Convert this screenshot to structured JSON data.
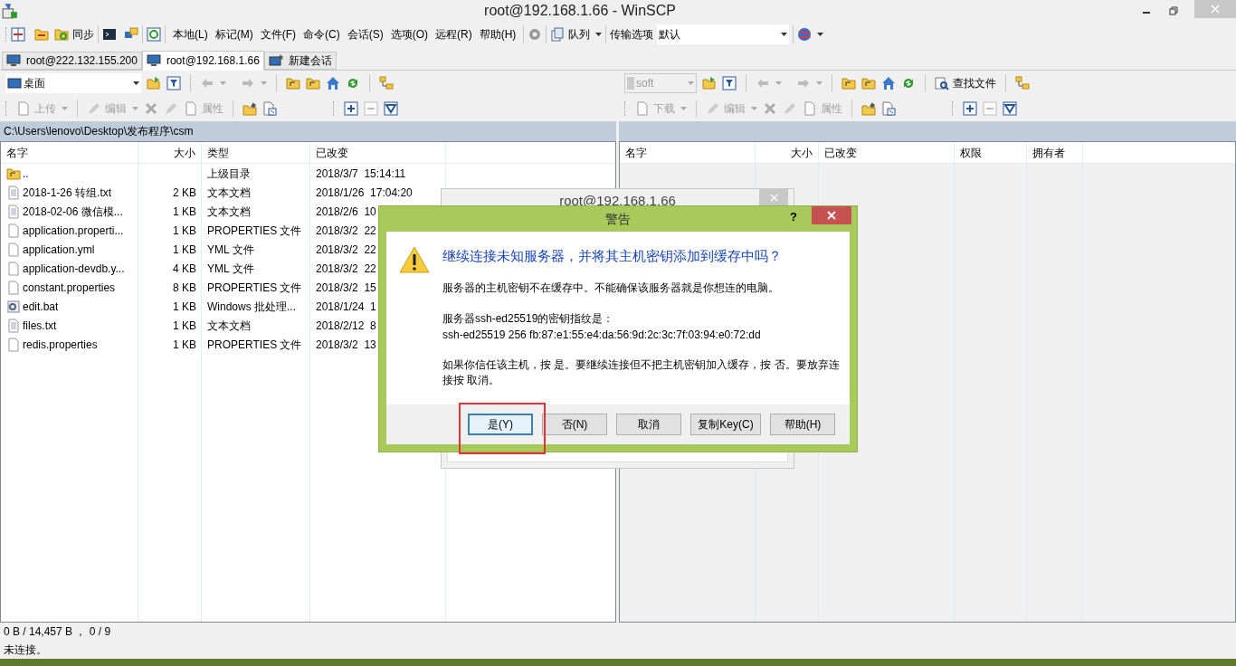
{
  "window": {
    "title": "root@192.168.1.66 - WinSCP"
  },
  "toolbar": {
    "sync_label": "同步",
    "menus": [
      "本地(L)",
      "标记(M)",
      "文件(F)",
      "命令(C)",
      "会话(S)",
      "选项(O)",
      "远程(R)",
      "帮助(H)"
    ],
    "queue_label": "队列",
    "transfer_label": "传输选项",
    "transfer_value": "默认"
  },
  "tabs": [
    {
      "label": "root@222.132.155.200",
      "selected": false
    },
    {
      "label": "root@192.168.1.66",
      "selected": true
    },
    {
      "label": "新建会话",
      "selected": false
    }
  ],
  "left_panel": {
    "location": "桌面",
    "location_disabled": false,
    "buttons": [
      {
        "label": "上传",
        "disabled": true
      },
      {
        "label": "编辑",
        "disabled": true
      },
      {
        "label": "属性",
        "disabled": true
      }
    ],
    "path": "C:\\Users\\lenovo\\Desktop\\发布程序\\csm",
    "columns": [
      "名字",
      "大小",
      "类型",
      "已改变"
    ],
    "rows": [
      {
        "kind": "parent",
        "name": "..",
        "type": "上级目录",
        "changed": "2018/3/7  15:14:11"
      },
      {
        "kind": "text",
        "name": "2018-1-26 转组.txt",
        "size": "2 KB",
        "type": "文本文档",
        "changed": "2018/1/26  17:04:20"
      },
      {
        "kind": "text",
        "name": "2018-02-06 微信模...",
        "size": "1 KB",
        "type": "文本文档",
        "changed": "2018/2/6  10"
      },
      {
        "kind": "file",
        "name": "application.properti...",
        "size": "1 KB",
        "type": "PROPERTIES 文件",
        "changed": "2018/3/2  22"
      },
      {
        "kind": "file",
        "name": "application.yml",
        "size": "1 KB",
        "type": "YML 文件",
        "changed": "2018/3/2  22"
      },
      {
        "kind": "file",
        "name": "application-devdb.y...",
        "size": "4 KB",
        "type": "YML 文件",
        "changed": "2018/3/2  22"
      },
      {
        "kind": "file",
        "name": "constant.properties",
        "size": "8 KB",
        "type": "PROPERTIES 文件",
        "changed": "2018/3/2  15"
      },
      {
        "kind": "batch",
        "name": "edit.bat",
        "size": "1 KB",
        "type": "Windows 批处理...",
        "changed": "2018/1/24  1"
      },
      {
        "kind": "text",
        "name": "files.txt",
        "size": "1 KB",
        "type": "文本文档",
        "changed": "2018/2/12  8"
      },
      {
        "kind": "file",
        "name": "redis.properties",
        "size": "1 KB",
        "type": "PROPERTIES 文件",
        "changed": "2018/3/2  13"
      }
    ]
  },
  "right_panel": {
    "location": "soft",
    "location_disabled": true,
    "find_label": "查找文件",
    "buttons": [
      {
        "label": "下载",
        "disabled": true
      },
      {
        "label": "编辑",
        "disabled": true
      },
      {
        "label": "属性",
        "disabled": true
      }
    ],
    "columns": [
      "名字",
      "大小",
      "已改变",
      "权限",
      "拥有者"
    ]
  },
  "background_window": {
    "title": "root@192.168.1.66"
  },
  "dialog": {
    "title": "警告",
    "help": "?",
    "question": "继续连接未知服务器，并将其主机密钥添加到缓存中吗？",
    "message": "服务器的主机密钥不在缓存中。不能确保该服务器就是你想连的电脑。",
    "fingerprint_label": "服务器ssh-ed25519的密钥指纹是：",
    "fingerprint": "ssh-ed25519 256 fb:87:e1:55:e4:da:56:9d:2c:3c:7f:03:94:e0:72:dd",
    "instructions": "如果你信任该主机，按 是。要继续连接但不把主机密钥加入缓存，按 否。要放弃连接按 取消。",
    "buttons": [
      {
        "label": "是(Y)",
        "selected": true,
        "highlighted": true
      },
      {
        "label": "否(N)",
        "selected": false,
        "highlighted": false
      },
      {
        "label": "取消",
        "selected": false,
        "highlighted": false
      },
      {
        "label": "复制Key(C)",
        "selected": false,
        "highlighted": false
      },
      {
        "label": "帮助(H)",
        "selected": false,
        "highlighted": false
      }
    ]
  },
  "status_bar": {
    "selection": "0 B / 14,457 B ， 0 / 9",
    "connection": "未连接。"
  }
}
